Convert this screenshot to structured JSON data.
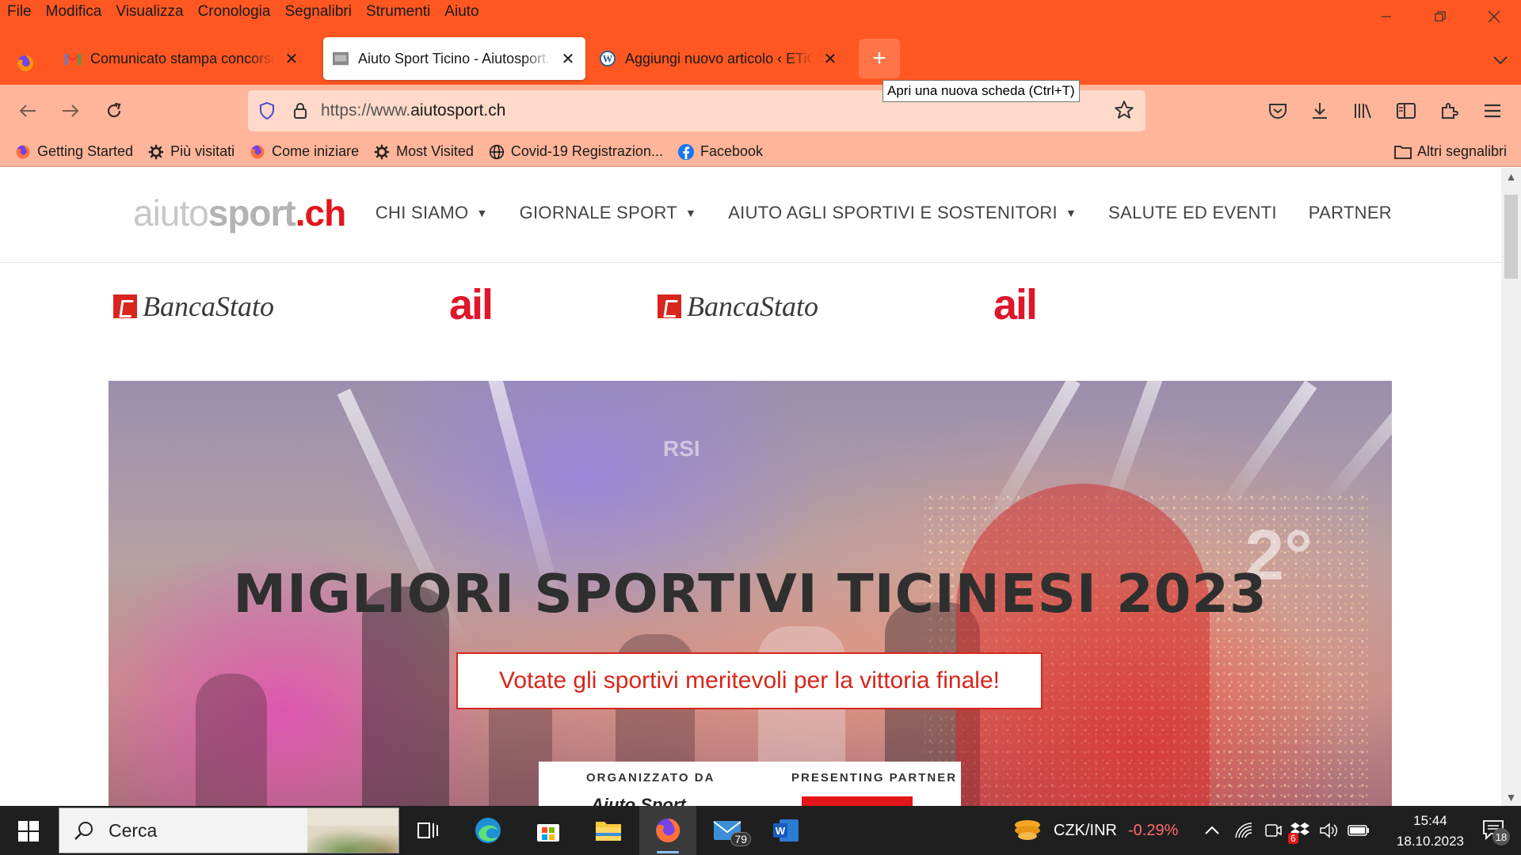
{
  "menubar": {
    "items": [
      "File",
      "Modifica",
      "Visualizza",
      "Cronologia",
      "Segnalibri",
      "Strumenti",
      "Aiuto"
    ]
  },
  "tabs": [
    {
      "title": "Comunicato stampa concorso M",
      "active": false
    },
    {
      "title": "Aiuto Sport Ticino - Aiutosport.ch",
      "active": true
    },
    {
      "title": "Aggiungi nuovo articolo ‹ ETiCinese",
      "active": false
    }
  ],
  "tooltip": "Apri una nuova scheda (Ctrl+T)",
  "urlbar": {
    "prefix": "https://www.",
    "domain": "aiutosport.ch"
  },
  "bookmarks": [
    {
      "label": "Getting Started",
      "icon": "firefox-icon"
    },
    {
      "label": "Più visitati",
      "icon": "gear-icon"
    },
    {
      "label": "Come iniziare",
      "icon": "firefox-icon"
    },
    {
      "label": "Most Visited",
      "icon": "gear-icon"
    },
    {
      "label": "Covid-19 Registrazion...",
      "icon": "globe-icon"
    },
    {
      "label": "Facebook",
      "icon": "facebook-icon"
    }
  ],
  "other_bookmarks": "Altri segnalibri",
  "site": {
    "logo": {
      "part1": "aiuto",
      "part2": "sport",
      "part3": ".ch"
    },
    "nav": [
      {
        "label": "CHI SIAMO",
        "dropdown": true
      },
      {
        "label": "GIORNALE SPORT",
        "dropdown": true
      },
      {
        "label": "AIUTO AGLI SPORTIVI E SOSTENITORI",
        "dropdown": true
      },
      {
        "label": "SALUTE ED EVENTI",
        "dropdown": false
      },
      {
        "label": "PARTNER",
        "dropdown": false
      }
    ],
    "sponsors": [
      "BancaStato",
      "ail",
      "BancaStato",
      "ail"
    ],
    "hero": {
      "title": "MIGLIORI SPORTIVI TICINESI 2023",
      "cta": "Votate gli sportivi meritevoli per la vittoria finale!",
      "organized_label": "ORGANIZZATO DA",
      "organized_name": "Aiuto Sport",
      "partner_label": "PRESENTING PARTNER",
      "screen_text": "RSI",
      "place": "2°"
    }
  },
  "taskbar": {
    "search_placeholder": "Cerca",
    "mail_badge": "79",
    "currency_pair": "CZK/INR",
    "currency_change": "-0.29%",
    "time": "15:44",
    "date": "18.10.2023",
    "notification_count": "18",
    "tray_badge": "6"
  },
  "colors": {
    "firefox_accent": "#ff5722",
    "navbar": "#ffb59a",
    "site_red": "#e3161b",
    "currency_negative": "#ff6b6b"
  }
}
